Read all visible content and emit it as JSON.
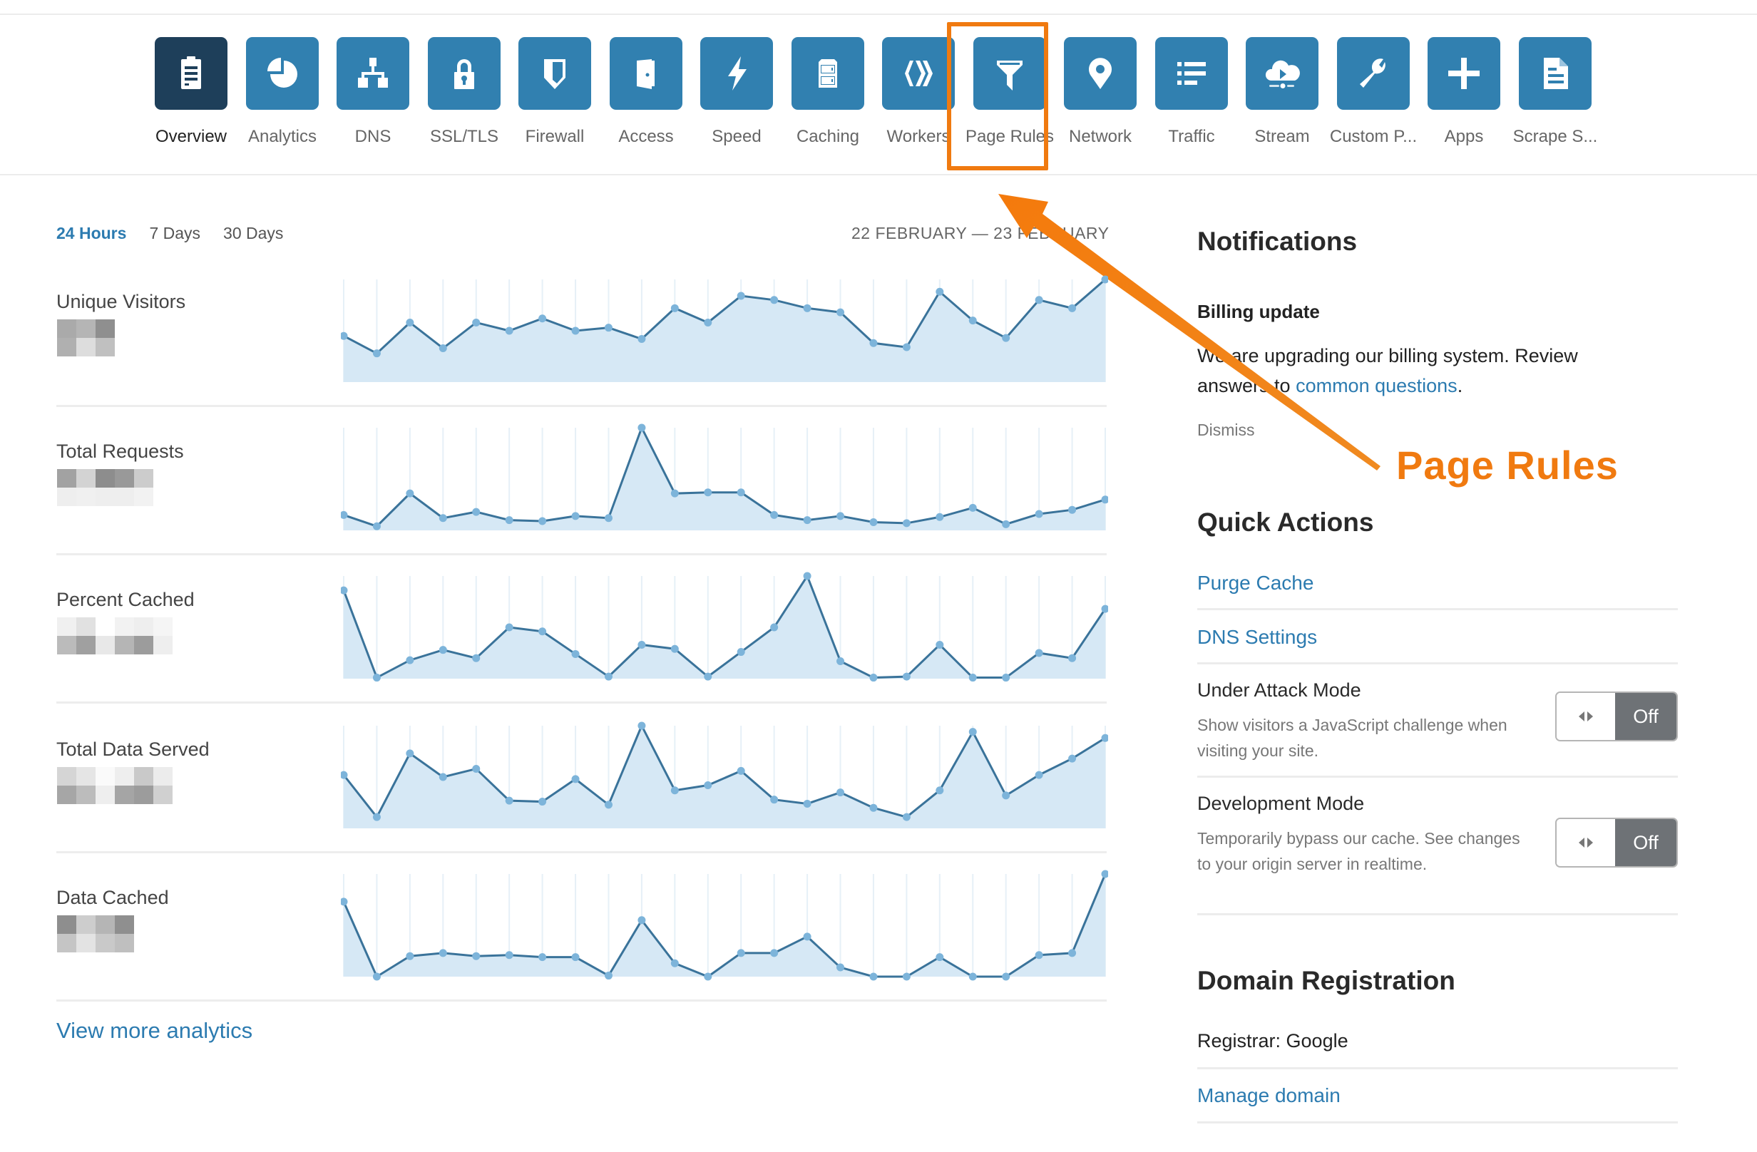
{
  "nav": {
    "items": [
      {
        "label": "Overview",
        "icon": "clipboard-icon",
        "active": true
      },
      {
        "label": "Analytics",
        "icon": "pie-chart-icon"
      },
      {
        "label": "DNS",
        "icon": "sitemap-icon"
      },
      {
        "label": "SSL/TLS",
        "icon": "lock-icon"
      },
      {
        "label": "Firewall",
        "icon": "shield-icon"
      },
      {
        "label": "Access",
        "icon": "door-icon"
      },
      {
        "label": "Speed",
        "icon": "lightning-icon"
      },
      {
        "label": "Caching",
        "icon": "server-icon"
      },
      {
        "label": "Workers",
        "icon": "workers-icon"
      },
      {
        "label": "Page Rules",
        "icon": "filter-icon"
      },
      {
        "label": "Network",
        "icon": "map-pin-icon"
      },
      {
        "label": "Traffic",
        "icon": "list-icon"
      },
      {
        "label": "Stream",
        "icon": "cloud-play-icon"
      },
      {
        "label": "Custom P...",
        "icon": "wrench-icon"
      },
      {
        "label": "Apps",
        "icon": "plus-icon"
      },
      {
        "label": "Scrape S...",
        "icon": "document-icon"
      }
    ]
  },
  "annotation": {
    "label": "Page Rules",
    "color": "#f07a10",
    "target": "Page Rules"
  },
  "analytics": {
    "range_tabs": [
      {
        "label": "24 Hours",
        "active": true
      },
      {
        "label": "7 Days"
      },
      {
        "label": "30 Days"
      }
    ],
    "date_range": "22 FEBRUARY — 23 FEBRUARY",
    "view_more": "View more analytics"
  },
  "chart_data": [
    {
      "type": "area",
      "title": "Unique Visitors",
      "x": [
        1,
        2,
        3,
        4,
        5,
        6,
        7,
        8,
        9,
        10,
        11,
        12,
        13,
        14,
        15,
        16,
        17,
        18,
        19,
        20,
        21,
        22,
        23,
        24
      ],
      "values": [
        45,
        28,
        58,
        33,
        58,
        50,
        62,
        50,
        53,
        42,
        72,
        58,
        84,
        80,
        72,
        68,
        38,
        34,
        88,
        60,
        43,
        80,
        72,
        100
      ],
      "ylim": [
        0,
        100
      ]
    },
    {
      "type": "area",
      "title": "Total Requests",
      "x": [
        1,
        2,
        3,
        4,
        5,
        6,
        7,
        8,
        9,
        10,
        11,
        12,
        13,
        14,
        15,
        16,
        17,
        18,
        19,
        20,
        21,
        22,
        23,
        24
      ],
      "values": [
        15,
        4,
        36,
        12,
        18,
        10,
        9,
        14,
        12,
        100,
        36,
        37,
        37,
        15,
        10,
        14,
        8,
        7,
        13,
        22,
        6,
        16,
        20,
        30
      ],
      "ylim": [
        0,
        100
      ]
    },
    {
      "type": "area",
      "title": "Percent Cached",
      "x": [
        1,
        2,
        3,
        4,
        5,
        6,
        7,
        8,
        9,
        10,
        11,
        12,
        13,
        14,
        15,
        16,
        17,
        18,
        19,
        20,
        21,
        22,
        23,
        24
      ],
      "values": [
        86,
        1,
        18,
        28,
        20,
        50,
        46,
        24,
        2,
        33,
        29,
        2,
        26,
        50,
        100,
        17,
        1,
        2,
        33,
        1,
        1,
        25,
        20,
        68
      ],
      "ylim": [
        0,
        100
      ]
    },
    {
      "type": "area",
      "title": "Total Data Served",
      "x": [
        1,
        2,
        3,
        4,
        5,
        6,
        7,
        8,
        9,
        10,
        11,
        12,
        13,
        14,
        15,
        16,
        17,
        18,
        19,
        20,
        21,
        22,
        23,
        24
      ],
      "values": [
        52,
        11,
        73,
        50,
        58,
        27,
        26,
        48,
        23,
        100,
        37,
        42,
        56,
        28,
        24,
        35,
        20,
        11,
        37,
        94,
        32,
        52,
        68,
        88
      ],
      "ylim": [
        0,
        100
      ]
    },
    {
      "type": "area",
      "title": "Data Cached",
      "x": [
        1,
        2,
        3,
        4,
        5,
        6,
        7,
        8,
        9,
        10,
        11,
        12,
        13,
        14,
        15,
        16,
        17,
        18,
        19,
        20,
        21,
        22,
        23,
        24
      ],
      "values": [
        73,
        0,
        20,
        23,
        20,
        21,
        19,
        19,
        1,
        55,
        13,
        0,
        23,
        23,
        39,
        9,
        0,
        0,
        19,
        0,
        0,
        21,
        23,
        100
      ],
      "ylim": [
        0,
        100
      ]
    }
  ],
  "notifications": {
    "heading": "Notifications",
    "item_title": "Billing update",
    "body_text": "We are upgrading our billing system. Review answers to ",
    "body_link": "common questions",
    "body_end": ".",
    "dismiss": "Dismiss"
  },
  "quick_actions": {
    "heading": "Quick Actions",
    "purge_cache": "Purge Cache",
    "dns_settings": "DNS Settings",
    "under_attack": {
      "title": "Under Attack Mode",
      "desc": "Show visitors a JavaScript challenge when visiting your site.",
      "state": "Off"
    },
    "dev_mode": {
      "title": "Development Mode",
      "desc": "Temporarily bypass our cache. See changes to your origin server in realtime.",
      "state": "Off"
    }
  },
  "domain_registration": {
    "heading": "Domain Registration",
    "registrar": "Registrar: Google",
    "manage": "Manage domain"
  },
  "colors": {
    "accent": "#3180b0",
    "active_tile": "#1e3f5a",
    "link": "#2c7bb0",
    "line": "#3a739a",
    "fill": "#d6e8f5",
    "dot": "#7db4da",
    "annotation": "#f07a10"
  }
}
